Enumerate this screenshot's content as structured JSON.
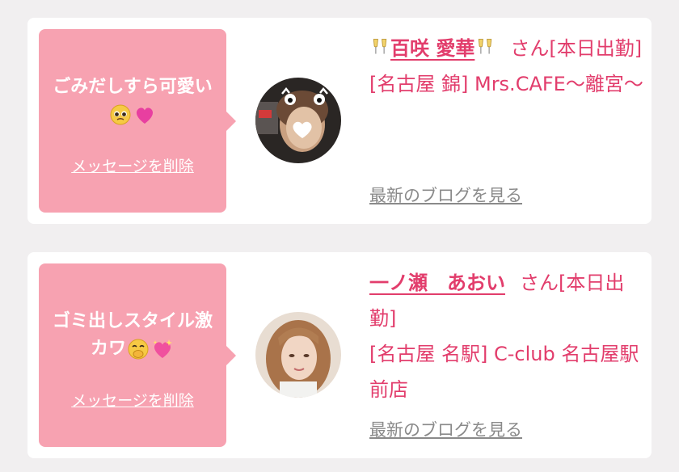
{
  "messages": [
    {
      "bubble_text": "ごみだしすら可愛い",
      "bubble_emojis": [
        "pleading-face-emoji",
        "pink-heart-emoji"
      ],
      "delete_label": "メッセージを削除",
      "name": "百咲 愛華",
      "name_icons": [
        "champagne-glasses-icon",
        "champagne-glasses-icon"
      ],
      "name_suffix": "さん[本日出勤]",
      "shop": "[名古屋 錦] Mrs.CAFE〜離宮〜",
      "blog_label": "最新のブログを見る"
    },
    {
      "bubble_text": "ゴミ出しスタイル激カワ",
      "bubble_emojis": [
        "hand-over-mouth-emoji",
        "sparkling-heart-emoji"
      ],
      "delete_label": "メッセージを削除",
      "name": "一ノ瀬　あおい",
      "name_suffix": "さん[本日出勤]",
      "shop": "[名古屋 名駅] C-club 名古屋駅前店",
      "blog_label": "最新のブログを見る"
    }
  ],
  "colors": {
    "background": "#f1eff0",
    "card": "#ffffff",
    "bubble": "#f7a2b1",
    "accent": "#e23d6c",
    "link_gray": "#8a8a8a"
  }
}
